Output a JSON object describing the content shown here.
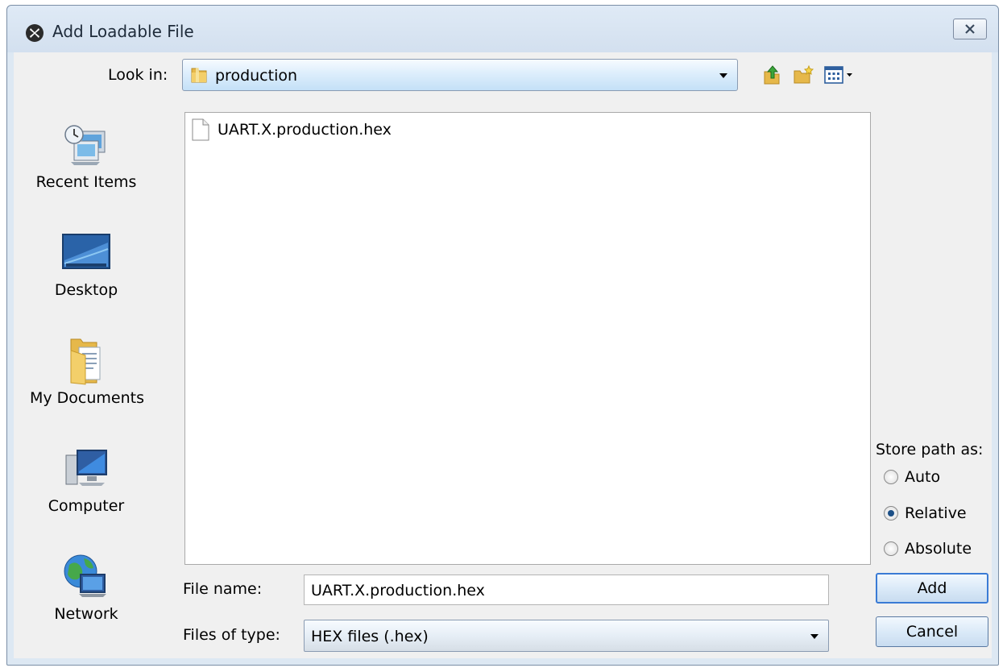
{
  "window": {
    "title": "Add Loadable File"
  },
  "look_in": {
    "label": "Look in:",
    "value": "production"
  },
  "toolbar": {
    "icons": [
      "up-folder-icon",
      "new-folder-icon",
      "view-menu-icon"
    ]
  },
  "places": [
    {
      "label": "Recent Items",
      "icon": "recent-items-icon"
    },
    {
      "label": "Desktop",
      "icon": "desktop-icon"
    },
    {
      "label": "My Documents",
      "icon": "my-documents-icon"
    },
    {
      "label": "Computer",
      "icon": "computer-icon"
    },
    {
      "label": "Network",
      "icon": "network-icon"
    }
  ],
  "files": [
    {
      "name": "UART.X.production.hex",
      "icon": "file-icon"
    }
  ],
  "store_path": {
    "title": "Store path as:",
    "options": [
      {
        "label": "Auto",
        "selected": false
      },
      {
        "label": "Relative",
        "selected": true
      },
      {
        "label": "Absolute",
        "selected": false
      }
    ]
  },
  "file_name": {
    "label": "File name:",
    "value": "UART.X.production.hex"
  },
  "file_type": {
    "label": "Files of type:",
    "value": "HEX files (.hex)"
  },
  "buttons": {
    "add": "Add",
    "cancel": "Cancel"
  }
}
